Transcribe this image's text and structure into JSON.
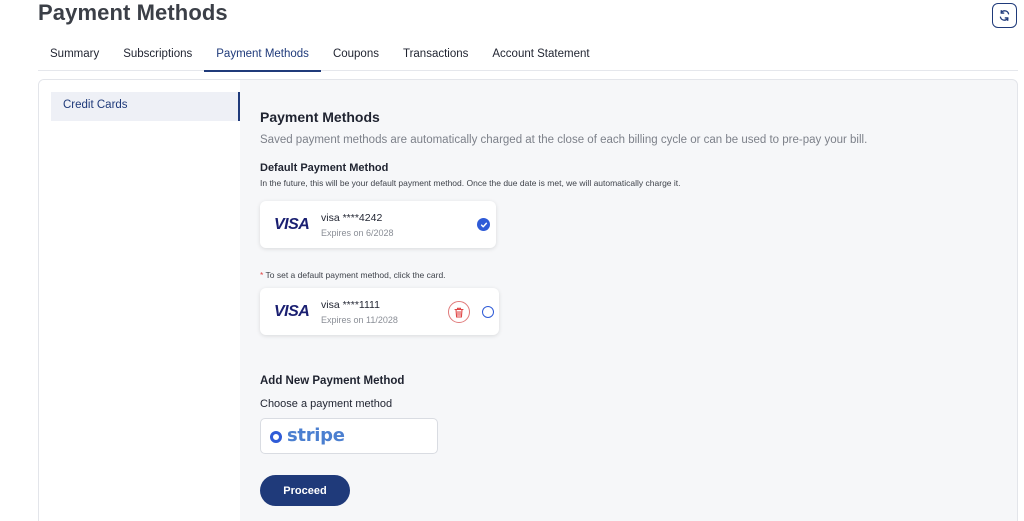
{
  "header": {
    "title": "Payment Methods",
    "refresh_icon": "refresh-icon"
  },
  "tabs": [
    {
      "label": "Summary",
      "active": false
    },
    {
      "label": "Subscriptions",
      "active": false
    },
    {
      "label": "Payment Methods",
      "active": true
    },
    {
      "label": "Coupons",
      "active": false
    },
    {
      "label": "Transactions",
      "active": false
    },
    {
      "label": "Account Statement",
      "active": false
    }
  ],
  "sidebar": {
    "items": [
      {
        "label": "Credit Cards",
        "active": true
      }
    ]
  },
  "main": {
    "heading": "Payment Methods",
    "description": "Saved payment methods are automatically charged at the close of each billing cycle or can be used to pre-pay your bill.",
    "default_heading": "Default Payment Method",
    "default_description": "In the future, this will be your default payment method. Once the due date is met, we will automatically charge it.",
    "cards": [
      {
        "brand": "VISA",
        "number": "visa ****4242",
        "expiry": "Expires on 6/2028",
        "default": true
      },
      {
        "brand": "VISA",
        "number": "visa ****1111",
        "expiry": "Expires on 11/2028",
        "default": false
      }
    ],
    "note_star": "*",
    "note": " To set a default payment method, click the card.",
    "add_heading": "Add New Payment Method",
    "choose_label": "Choose a payment method",
    "provider": "stripe",
    "proceed_label": "Proceed"
  },
  "colors": {
    "accent": "#1f3a7a",
    "check": "#2f5bd7",
    "danger": "#e04545"
  }
}
